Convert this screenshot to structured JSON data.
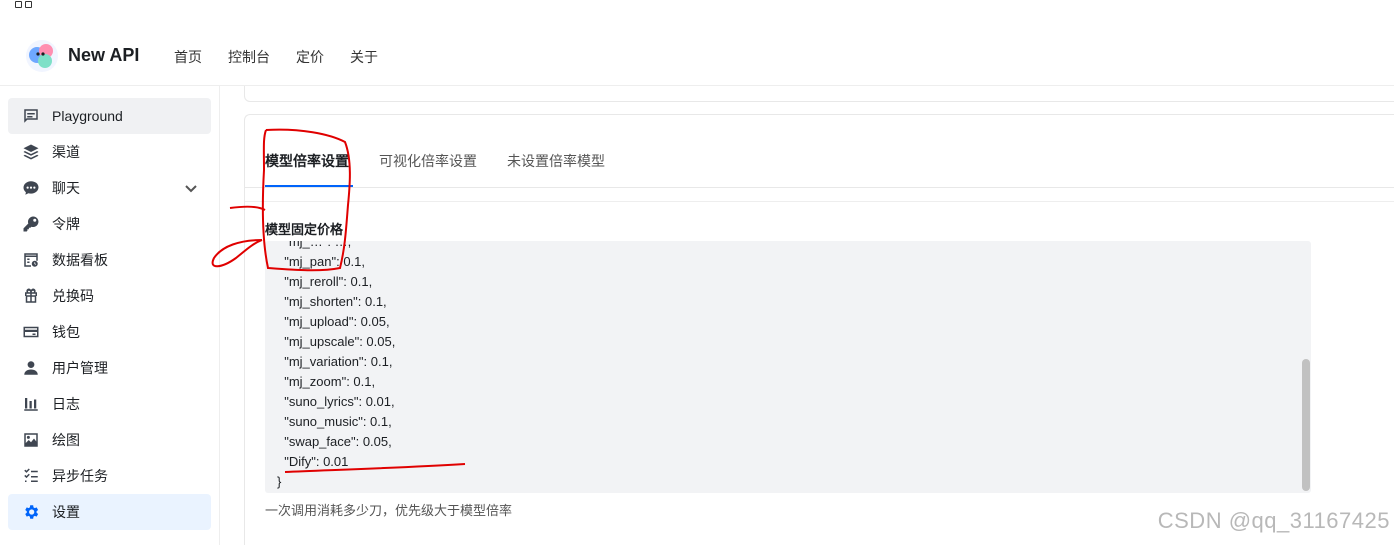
{
  "app": {
    "name": "New API"
  },
  "header": {
    "nav": [
      "首页",
      "控制台",
      "定价",
      "关于"
    ]
  },
  "sidebar": {
    "items": [
      {
        "label": "Playground",
        "icon": "chat-square-icon"
      },
      {
        "label": "渠道",
        "icon": "layers-icon"
      },
      {
        "label": "聊天",
        "icon": "chat-bubble-icon"
      },
      {
        "label": "令牌",
        "icon": "key-icon"
      },
      {
        "label": "数据看板",
        "icon": "dashboard-icon"
      },
      {
        "label": "兑换码",
        "icon": "gift-icon"
      },
      {
        "label": "钱包",
        "icon": "wallet-icon"
      },
      {
        "label": "用户管理",
        "icon": "user-icon"
      },
      {
        "label": "日志",
        "icon": "bar-chart-icon"
      },
      {
        "label": "绘图",
        "icon": "image-icon"
      },
      {
        "label": "异步任务",
        "icon": "task-list-icon"
      },
      {
        "label": "设置",
        "icon": "gear-icon"
      }
    ]
  },
  "tabs": [
    {
      "label": "模型倍率设置"
    },
    {
      "label": "可视化倍率设置"
    },
    {
      "label": "未设置倍率模型"
    }
  ],
  "section": {
    "label": "模型固定价格",
    "help": "一次调用消耗多少刀，优先级大于模型倍率"
  },
  "code": {
    "lines": [
      "  \"mj_…\": …,",
      "  \"mj_pan\": 0.1,",
      "  \"mj_reroll\": 0.1,",
      "  \"mj_shorten\": 0.1,",
      "  \"mj_upload\": 0.05,",
      "  \"mj_upscale\": 0.05,",
      "  \"mj_variation\": 0.1,",
      "  \"mj_zoom\": 0.1,",
      "  \"suno_lyrics\": 0.01,",
      "  \"suno_music\": 0.1,",
      "  \"swap_face\": 0.05,",
      "  \"Dify\": 0.01",
      "}"
    ]
  },
  "watermark": "CSDN @qq_31167425",
  "colors": {
    "accent": "#0064fa",
    "annotation": "#e00000"
  }
}
